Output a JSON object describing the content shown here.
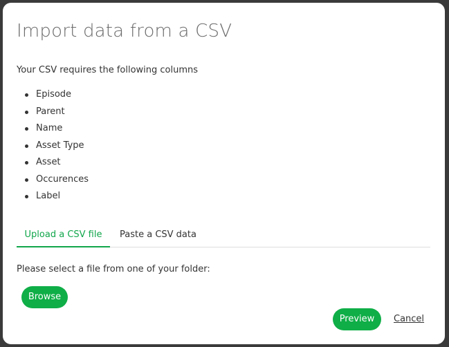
{
  "dialog": {
    "title": "Import data from a CSV",
    "intro": "Your CSV requires the following columns",
    "columns": [
      "Episode",
      "Parent",
      "Name",
      "Asset Type",
      "Asset",
      "Occurences",
      "Label"
    ],
    "tabs": {
      "upload": "Upload a CSV file",
      "paste": "Paste a CSV data",
      "active": "upload"
    },
    "select_text": "Please select a file from one of your folder:",
    "browse_label": "Browse",
    "preview_label": "Preview",
    "cancel_label": "Cancel",
    "colors": {
      "accent": "#0fae47",
      "text": "#333333",
      "title": "#6b6b6b",
      "backdrop": "#3a3a3a"
    }
  }
}
